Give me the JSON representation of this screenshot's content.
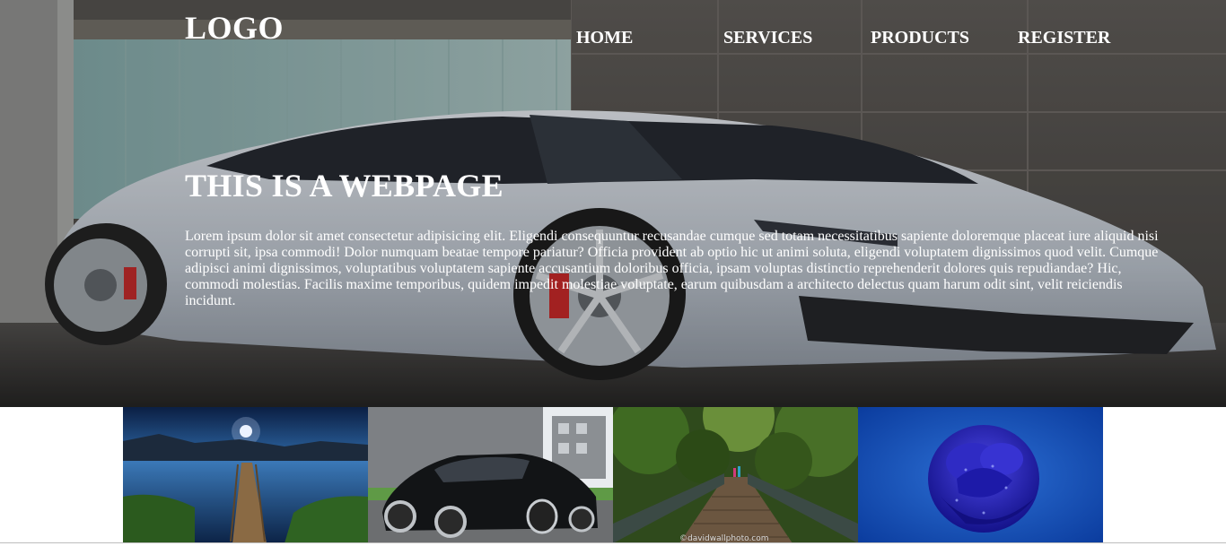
{
  "header": {
    "logo": "LOGO",
    "nav": {
      "home": "HOME",
      "services": "SERVICES",
      "products": "PRODUCTS",
      "register": "REGISTER"
    }
  },
  "hero": {
    "title": "THIS IS A WEBPAGE",
    "text": "Lorem ipsum dolor sit amet consectetur adipisicing elit. Eligendi consequuntur recusandae cumque sed totam necessitatibus sapiente doloremque placeat iure aliquid nisi corrupti sit, ipsa commodi! Dolor numquam beatae tempore pariatur? Officia provident ab optio hic ut animi soluta, eligendi voluptatem dignissimos quod velit. Cumque adipisci animi dignissimos, voluptatibus voluptatem sapiente accusantium doloribus officia, ipsam voluptas distinctio reprehenderit dolores quis repudiandae? Hic, commodi molestias. Facilis maxime temporibus, quidem impedit molestiae voluptate, earum quibusdam a architecto delectus quam harum odit sint, velit reiciendis incidunt."
  },
  "gallery": {
    "items": [
      {
        "icon": "lake-pier-image"
      },
      {
        "icon": "black-sports-car-image"
      },
      {
        "icon": "forest-bridge-image",
        "watermark": "©davidwallphoto.com"
      },
      {
        "icon": "blue-rose-image"
      }
    ]
  },
  "colors": {
    "text": "#ffffff",
    "page_background": "#ffffff",
    "hero_overlay": "#2a2a2a"
  }
}
